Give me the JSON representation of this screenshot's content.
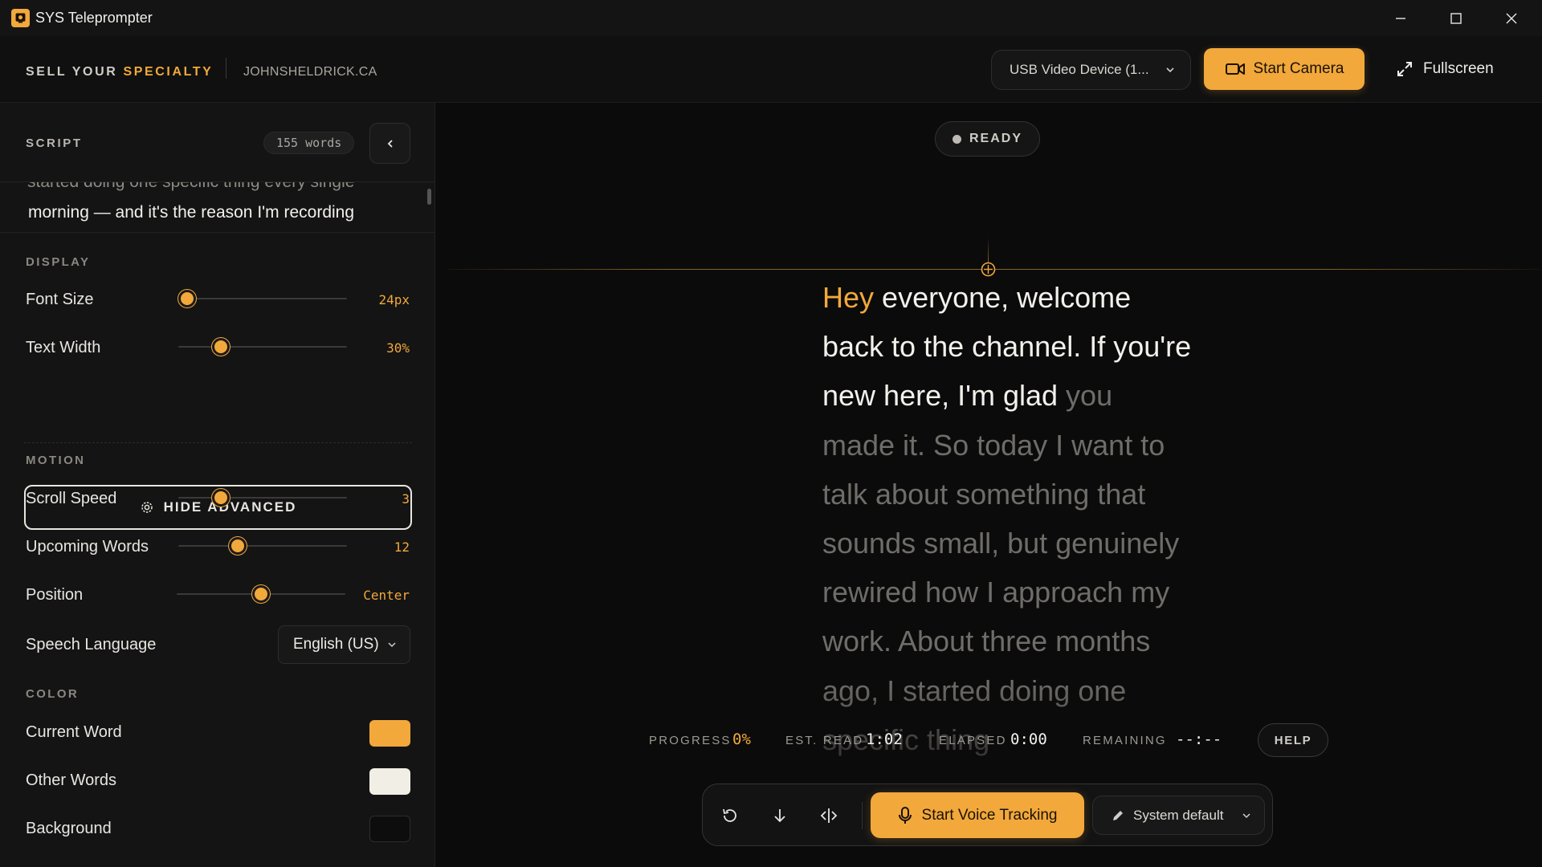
{
  "window": {
    "title": "SYS Teleprompter",
    "minimize_icon": "minimize-icon",
    "maximize_icon": "maximize-icon",
    "close_icon": "close-icon"
  },
  "header": {
    "brand_prefix": "SELL YOUR",
    "brand_accent": "SPECIALTY",
    "site": "JOHNSHELDRICK.CA",
    "device_select": "USB Video Device (1...",
    "start_camera": "Start Camera",
    "fullscreen": "Fullscreen"
  },
  "sidebar": {
    "script_title": "SCRIPT",
    "word_count": "155 words",
    "script_prev_line": "started doing one specific thing every single",
    "script_line": "morning — and it's the reason I'm recording",
    "display": {
      "label": "DISPLAY",
      "font_size": {
        "label": "Font Size",
        "value": "24px",
        "level": 0.05
      },
      "text_width": {
        "label": "Text Width",
        "value": "30%",
        "level": 0.25
      }
    },
    "hide_advanced": "HIDE ADVANCED",
    "motion": {
      "label": "MOTION",
      "scroll_speed": {
        "label": "Scroll Speed",
        "value": "3",
        "level": 0.25
      },
      "upcoming_words": {
        "label": "Upcoming Words",
        "value": "12",
        "level": 0.35
      },
      "position": {
        "label": "Position",
        "value": "Center",
        "level": 0.5
      },
      "speech_language": {
        "label": "Speech Language",
        "value": "English (US)"
      }
    },
    "color": {
      "label": "COLOR",
      "current_word": {
        "label": "Current Word",
        "color": "#F2A83B"
      },
      "other_words": {
        "label": "Other Words",
        "color": "#F1EEE6"
      },
      "background": {
        "label": "Background",
        "color": "#0D0D0D"
      }
    }
  },
  "stage": {
    "status": "READY",
    "current_word": "Hey",
    "active_text": "everyone, welcome back to the channel. If you're new here, I'm glad",
    "upcoming_text": "you made it. So today I want to talk about something that sounds small, but genuinely rewired how I approach my work. About three months ago, I started doing one specific thing",
    "stats": {
      "progress_label": "PROGRESS",
      "progress_value": "0%",
      "est_read_label": "EST. READ",
      "est_read_value": "1:02",
      "elapsed_label": "ELAPSED",
      "elapsed_value": "0:00",
      "remaining_label": "REMAINING",
      "remaining_value": "--:--"
    },
    "help": "HELP",
    "controls": {
      "reset_icon": "reset-icon",
      "scroll_down_icon": "arrow-down-icon",
      "mirror_icon": "mirror-icon",
      "voice_tracking": "Start Voice Tracking",
      "mic_select": "System default"
    }
  },
  "colors": {
    "accent": "#F2A83B",
    "panel": "#141414",
    "stage_bg": "#0B0B0B"
  }
}
